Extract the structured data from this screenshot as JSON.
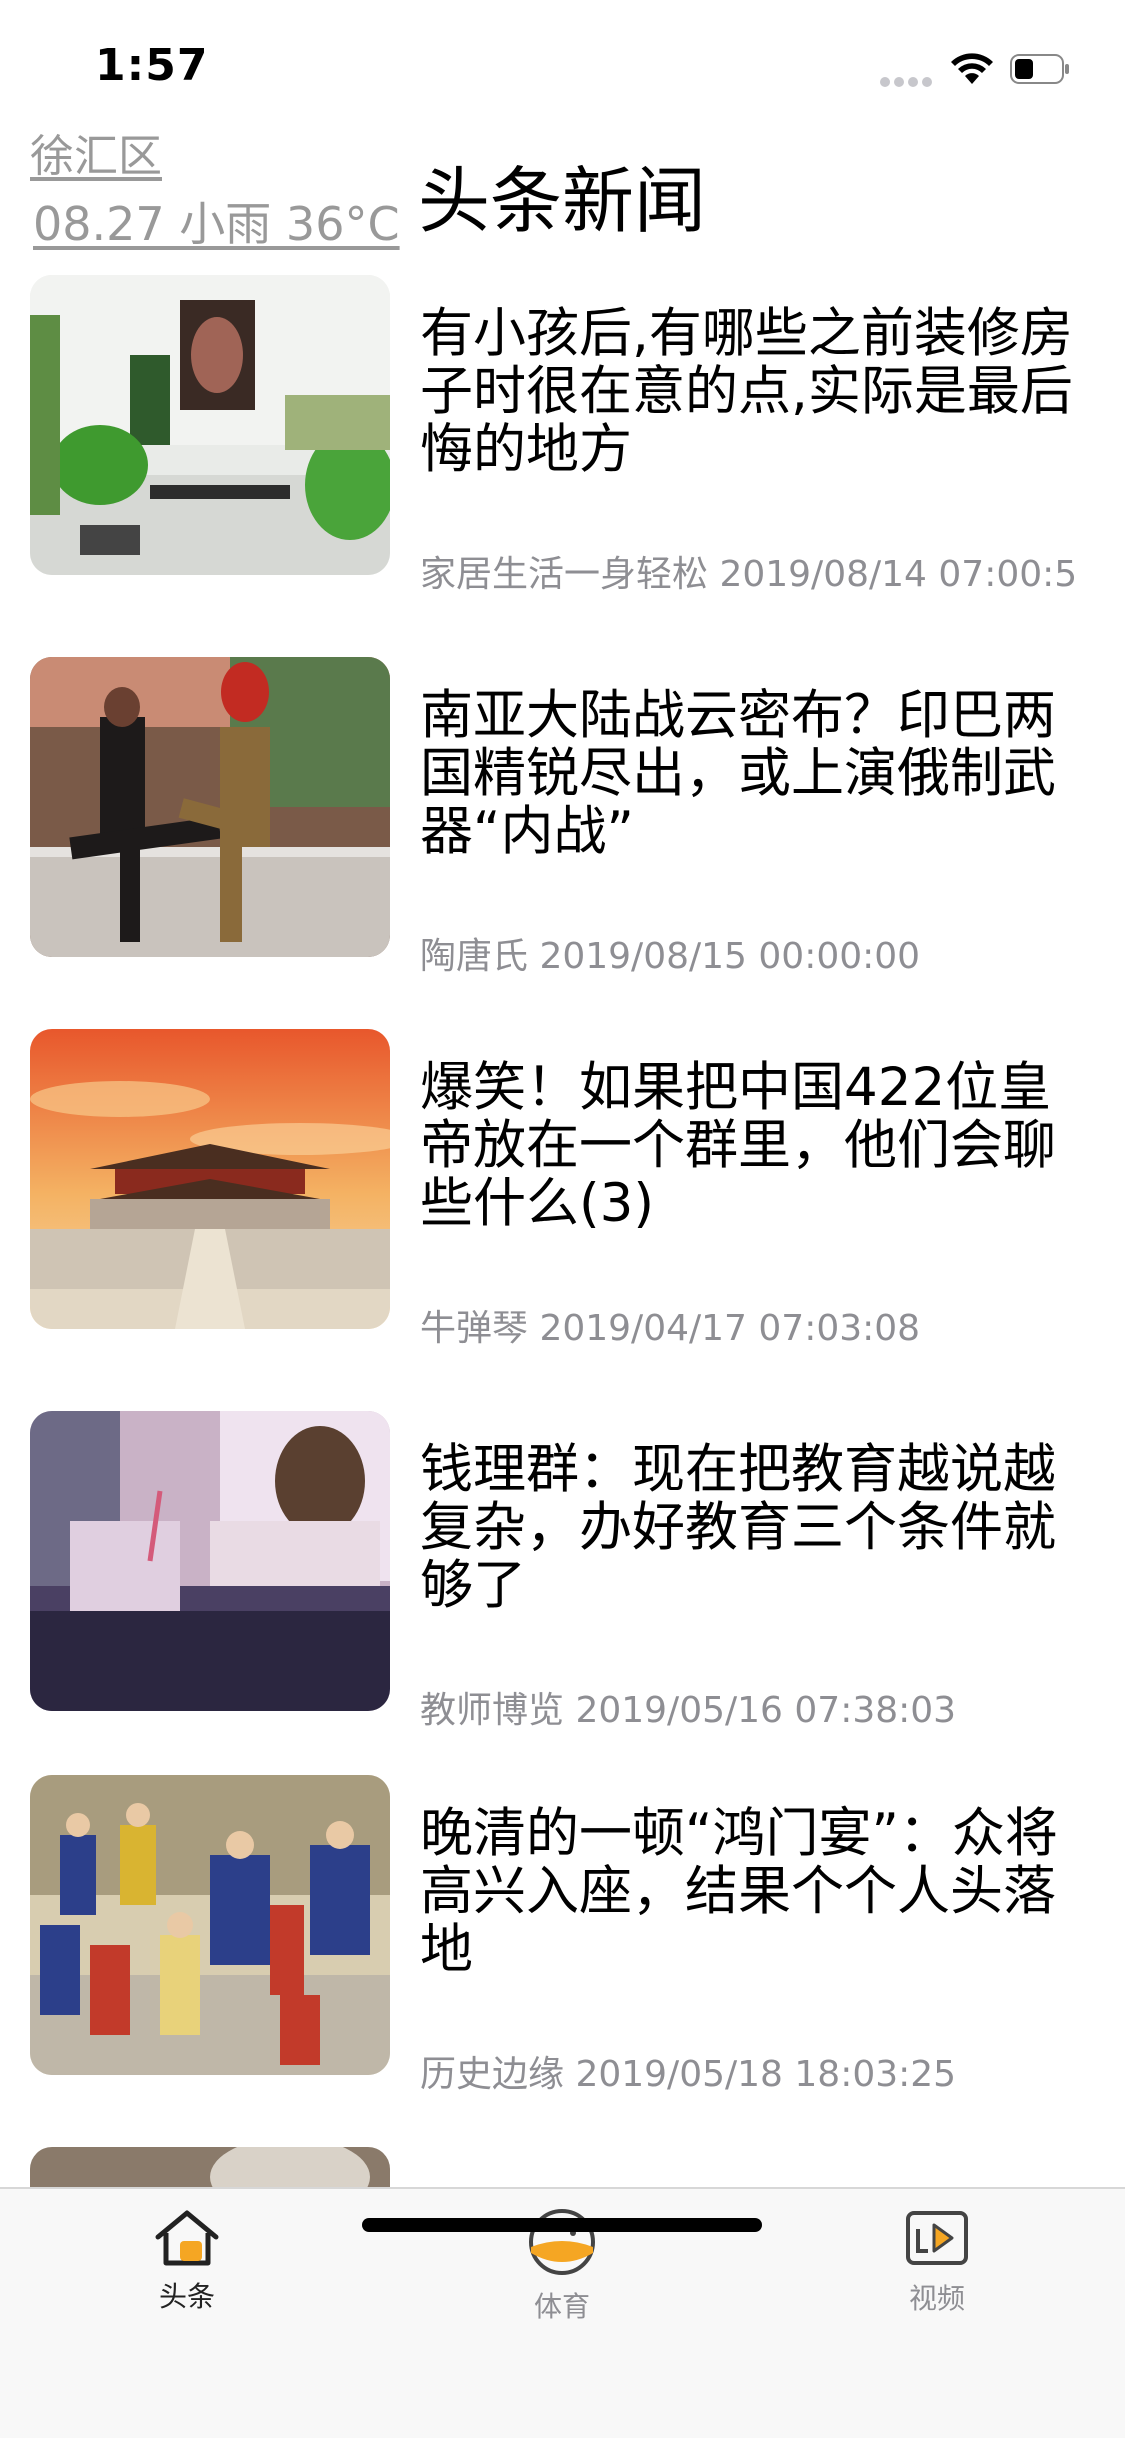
{
  "status_bar": {
    "time": "1:57"
  },
  "header": {
    "location": "徐汇区",
    "weather": "08.27 小雨 36°C",
    "title": "头条新闻"
  },
  "news": [
    {
      "title": "有小孩后,有哪些之前装修房子时很在意的点,实际是最后悔的地方",
      "meta": "家居生活一身轻松 2019/08/14 07:00:5"
    },
    {
      "title": "南亚大陆战云密布？印巴两国精锐尽出，或上演俄制武器“内战”",
      "meta": "陶唐氏 2019/08/15 00:00:00"
    },
    {
      "title": "爆笑！如果把中国422位皇帝放在一个群里，他们会聊些什么(3)",
      "meta": "牛弹琴 2019/04/17 07:03:08"
    },
    {
      "title": "钱理群：现在把教育越说越复杂，办好教育三个条件就够了",
      "meta": "教师博览 2019/05/16 07:38:03"
    },
    {
      "title": "晚清的一顿“鸿门宴”：众将高兴入座，结果个个人头落地",
      "meta": "历史边缘 2019/05/18 18:03:25"
    }
  ],
  "tabs": [
    {
      "label": "头条",
      "icon": "home-icon"
    },
    {
      "label": "体育",
      "icon": "ball-icon"
    },
    {
      "label": "视频",
      "icon": "video-icon"
    }
  ],
  "colors": {
    "accent": "#f5a623",
    "meta_text": "#8e8e93",
    "location_text": "#999999"
  }
}
